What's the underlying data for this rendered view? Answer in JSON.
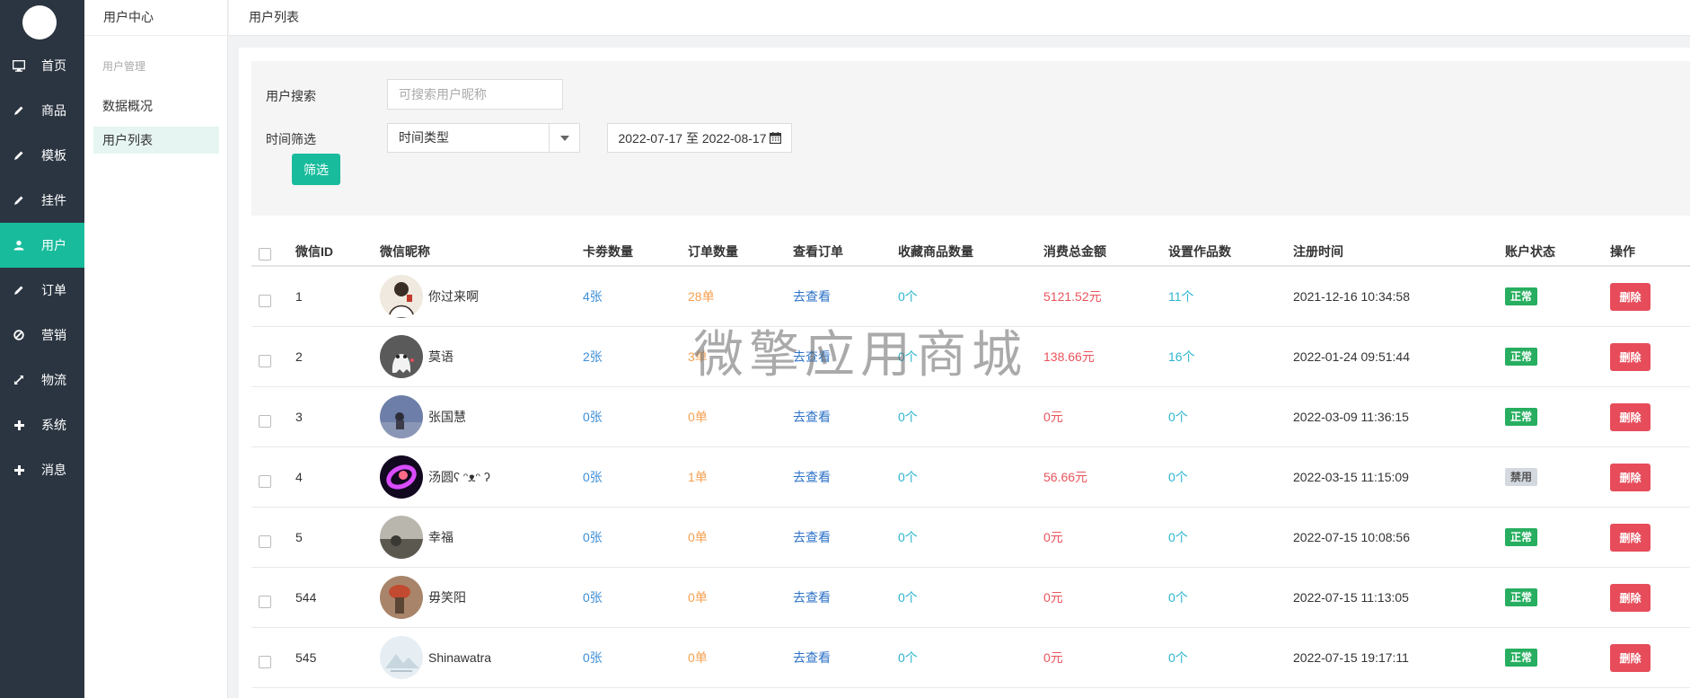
{
  "nav": [
    {
      "label": "首页",
      "icon": "monitor-icon"
    },
    {
      "label": "商品",
      "icon": "pencil-icon"
    },
    {
      "label": "模板",
      "icon": "pencil-icon"
    },
    {
      "label": "挂件",
      "icon": "pencil-icon"
    },
    {
      "label": "用户",
      "icon": "user-icon",
      "active": true
    },
    {
      "label": "订单",
      "icon": "pencil-icon"
    },
    {
      "label": "营销",
      "icon": "ban-icon"
    },
    {
      "label": "物流",
      "icon": "expand-icon"
    },
    {
      "label": "系统",
      "icon": "plus-icon"
    },
    {
      "label": "消息",
      "icon": "plus-icon"
    }
  ],
  "submenu": {
    "title": "用户中心",
    "group": "用户管理",
    "items": [
      {
        "label": "数据概况"
      },
      {
        "label": "用户列表",
        "active": true
      }
    ]
  },
  "page_title": "用户列表",
  "filter": {
    "search_label": "用户搜索",
    "search_placeholder": "可搜索用户昵称",
    "time_label": "时间筛选",
    "time_type": "时间类型",
    "date_range": "2022-07-17 至 2022-08-17",
    "submit_label": "筛选"
  },
  "table": {
    "headers": [
      "微信ID",
      "微信昵称",
      "卡劵数量",
      "订单数量",
      "查看订单",
      "收藏商品数量",
      "消费总金额",
      "设置作品数",
      "注册时间",
      "账户状态",
      "操作"
    ],
    "rows": [
      {
        "id": "1",
        "nickname": "你过来啊",
        "coupons": "4张",
        "orders": "28单",
        "view": "去查看",
        "favs": "0个",
        "amount": "5121.52元",
        "works": "11个",
        "reg_time": "2021-12-16 10:34:58",
        "status": "正常",
        "action": "删除"
      },
      {
        "id": "2",
        "nickname": "莫语",
        "coupons": "2张",
        "orders": "3单",
        "view": "去查看",
        "favs": "0个",
        "amount": "138.66元",
        "works": "16个",
        "reg_time": "2022-01-24 09:51:44",
        "status": "正常",
        "action": "删除"
      },
      {
        "id": "3",
        "nickname": "张国慧",
        "coupons": "0张",
        "orders": "0单",
        "view": "去查看",
        "favs": "0个",
        "amount": "0元",
        "works": "0个",
        "reg_time": "2022-03-09 11:36:15",
        "status": "正常",
        "action": "删除"
      },
      {
        "id": "4",
        "nickname": "汤圆ʕ ᵔᴥᵔ ʔ",
        "coupons": "0张",
        "orders": "1单",
        "view": "去查看",
        "favs": "0个",
        "amount": "56.66元",
        "works": "0个",
        "reg_time": "2022-03-15 11:15:09",
        "status": "禁用",
        "action": "删除"
      },
      {
        "id": "5",
        "nickname": "幸福",
        "coupons": "0张",
        "orders": "0单",
        "view": "去查看",
        "favs": "0个",
        "amount": "0元",
        "works": "0个",
        "reg_time": "2022-07-15 10:08:56",
        "status": "正常",
        "action": "删除"
      },
      {
        "id": "544",
        "nickname": "毋笑阳",
        "coupons": "0张",
        "orders": "0单",
        "view": "去查看",
        "favs": "0个",
        "amount": "0元",
        "works": "0个",
        "reg_time": "2022-07-15 11:13:05",
        "status": "正常",
        "action": "删除"
      },
      {
        "id": "545",
        "nickname": "Shinawatra",
        "coupons": "0张",
        "orders": "0单",
        "view": "去查看",
        "favs": "0个",
        "amount": "0元",
        "works": "0个",
        "reg_time": "2022-07-15 19:17:11",
        "status": "正常",
        "action": "删除"
      }
    ]
  },
  "watermark": "微擎应用商城",
  "colors": {
    "sidebar": "#2b3541",
    "accent": "#18bc9c",
    "danger": "#e74c5a",
    "ok": "#27ae60"
  }
}
